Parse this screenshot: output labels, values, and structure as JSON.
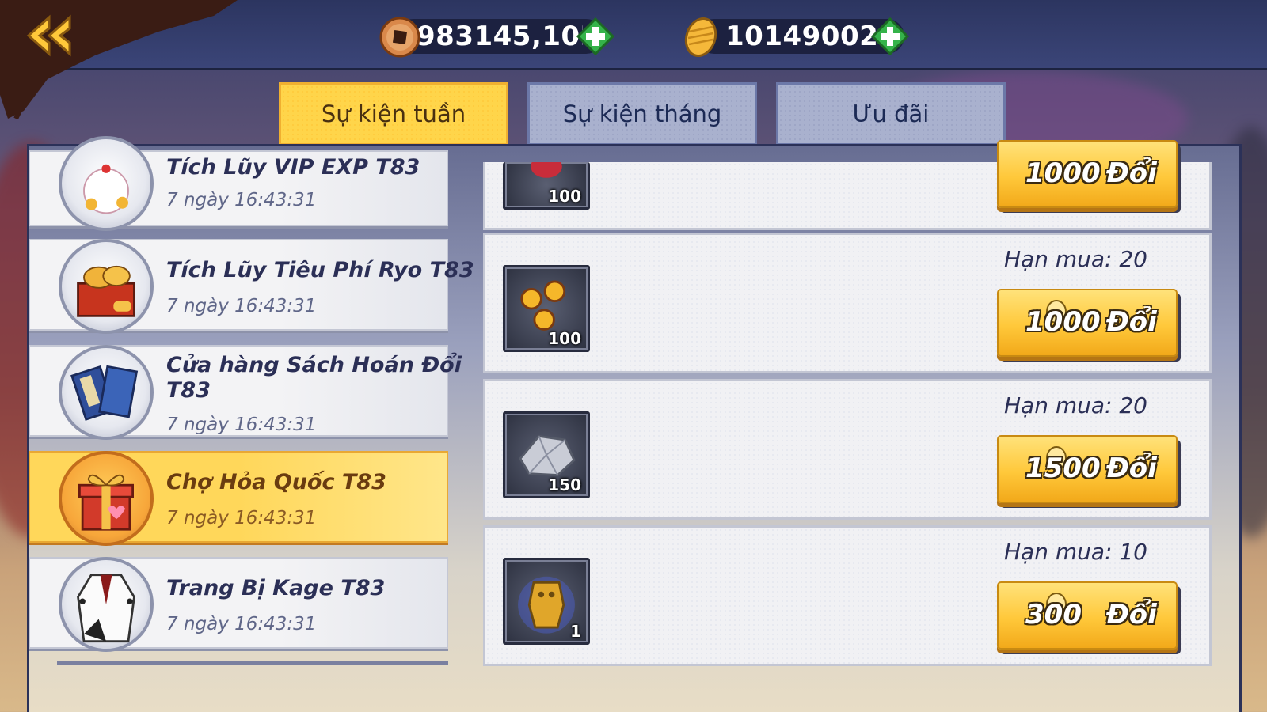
{
  "currencies": [
    {
      "name": "copper-coin",
      "value": "983145,10M"
    },
    {
      "name": "ryo-gold",
      "value": "10149002"
    }
  ],
  "tabs": [
    {
      "label": "Sự kiện tuần",
      "active": true
    },
    {
      "label": "Sự kiện tháng",
      "active": false
    },
    {
      "label": "Ưu đãi",
      "active": false
    }
  ],
  "events": [
    {
      "title": "Tích Lũy VIP EXP T83",
      "time": "7 ngày 16:43:31",
      "icon": "lucky-cat-icon"
    },
    {
      "title": "Tích Lũy Tiêu Phí Ryo T83",
      "time": "7 ngày 16:43:31",
      "icon": "treasure-box-icon"
    },
    {
      "title_line1": "Cửa hàng Sách Hoán Đổi",
      "title_line2": "T83",
      "time": "7 ngày 16:43:31",
      "icon": "books-icon"
    },
    {
      "title": "Chợ Hỏa Quốc T83",
      "time": "7 ngày 16:43:31",
      "icon": "gift-box-icon",
      "active": true
    },
    {
      "title": "Trang Bị Kage T83",
      "time": "7 ngày 16:43:31",
      "icon": "kage-robe-icon"
    }
  ],
  "shop_items": [
    {
      "qty": "100",
      "price": "1000",
      "action": "Đổi",
      "icon": "red-orb-icon"
    },
    {
      "qty": "100",
      "limit": "Hạn mua: 20",
      "price": "1000",
      "action": "Đổi",
      "icon": "sharingan-tomoe-icon"
    },
    {
      "qty": "150",
      "limit": "Hạn mua: 20",
      "price": "1500",
      "action": "Đổi",
      "icon": "silver-ore-icon"
    },
    {
      "qty": "1",
      "limit": "Hạn mua: 10",
      "price": "300",
      "action": "Đổi",
      "icon": "golden-statue-icon"
    }
  ],
  "colors": {
    "accent": "#ffd54a",
    "header": "#2c3560",
    "plus": "#35b34a"
  }
}
